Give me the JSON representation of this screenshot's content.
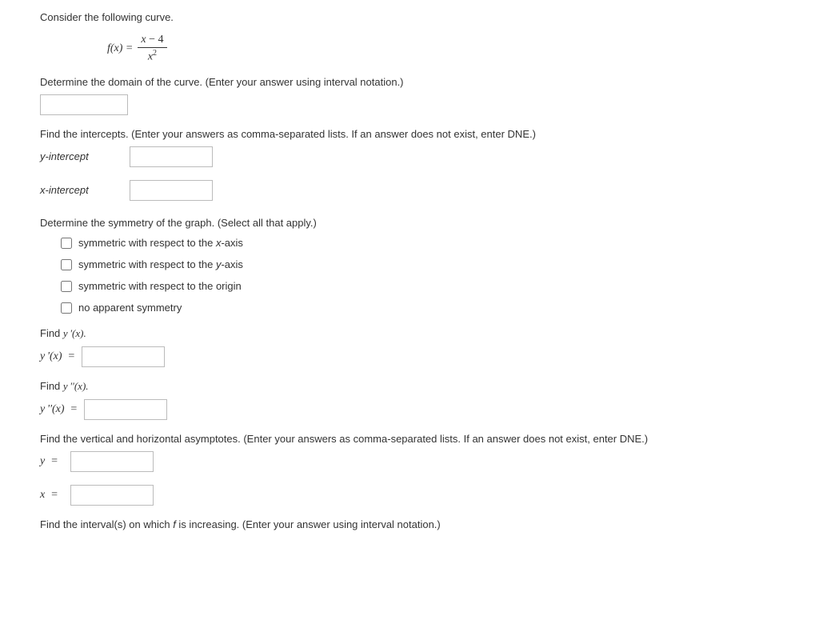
{
  "intro": "Consider the following curve.",
  "formula": {
    "left": "f(x) =",
    "num_a": "x",
    "num_op": " − ",
    "num_b": "4",
    "den_base": "x",
    "den_exp": "2"
  },
  "domain": {
    "prompt": "Determine the domain of the curve. (Enter your answer using interval notation.)"
  },
  "intercepts": {
    "prompt": "Find the intercepts. (Enter your answers as comma-separated lists. If an answer does not exist, enter DNE.)",
    "y_label": "y-intercept",
    "x_label": "x-intercept"
  },
  "symmetry": {
    "prompt": "Determine the symmetry of the graph. (Select all that apply.)",
    "options": {
      "xaxis": "symmetric with respect to the x-axis",
      "yaxis": "symmetric with respect to the y-axis",
      "origin": "symmetric with respect to the origin",
      "none": "no apparent symmetry"
    }
  },
  "deriv1": {
    "prompt_pre": "Find ",
    "prompt_math": "y '(x).",
    "label": "y '(x)  ="
  },
  "deriv2": {
    "prompt_pre": "Find ",
    "prompt_math": "y ''(x).",
    "label": "y ''(x)  ="
  },
  "asymptotes": {
    "prompt": "Find the vertical and horizontal asymptotes. (Enter your answers as comma-separated lists. If an answer does not exist, enter DNE.)",
    "y_label": "y  =",
    "x_label": "x  ="
  },
  "increasing": {
    "prompt_pre": "Find the interval(s) on which ",
    "prompt_f": "f",
    "prompt_post": " is increasing. (Enter your answer using interval notation.)"
  }
}
